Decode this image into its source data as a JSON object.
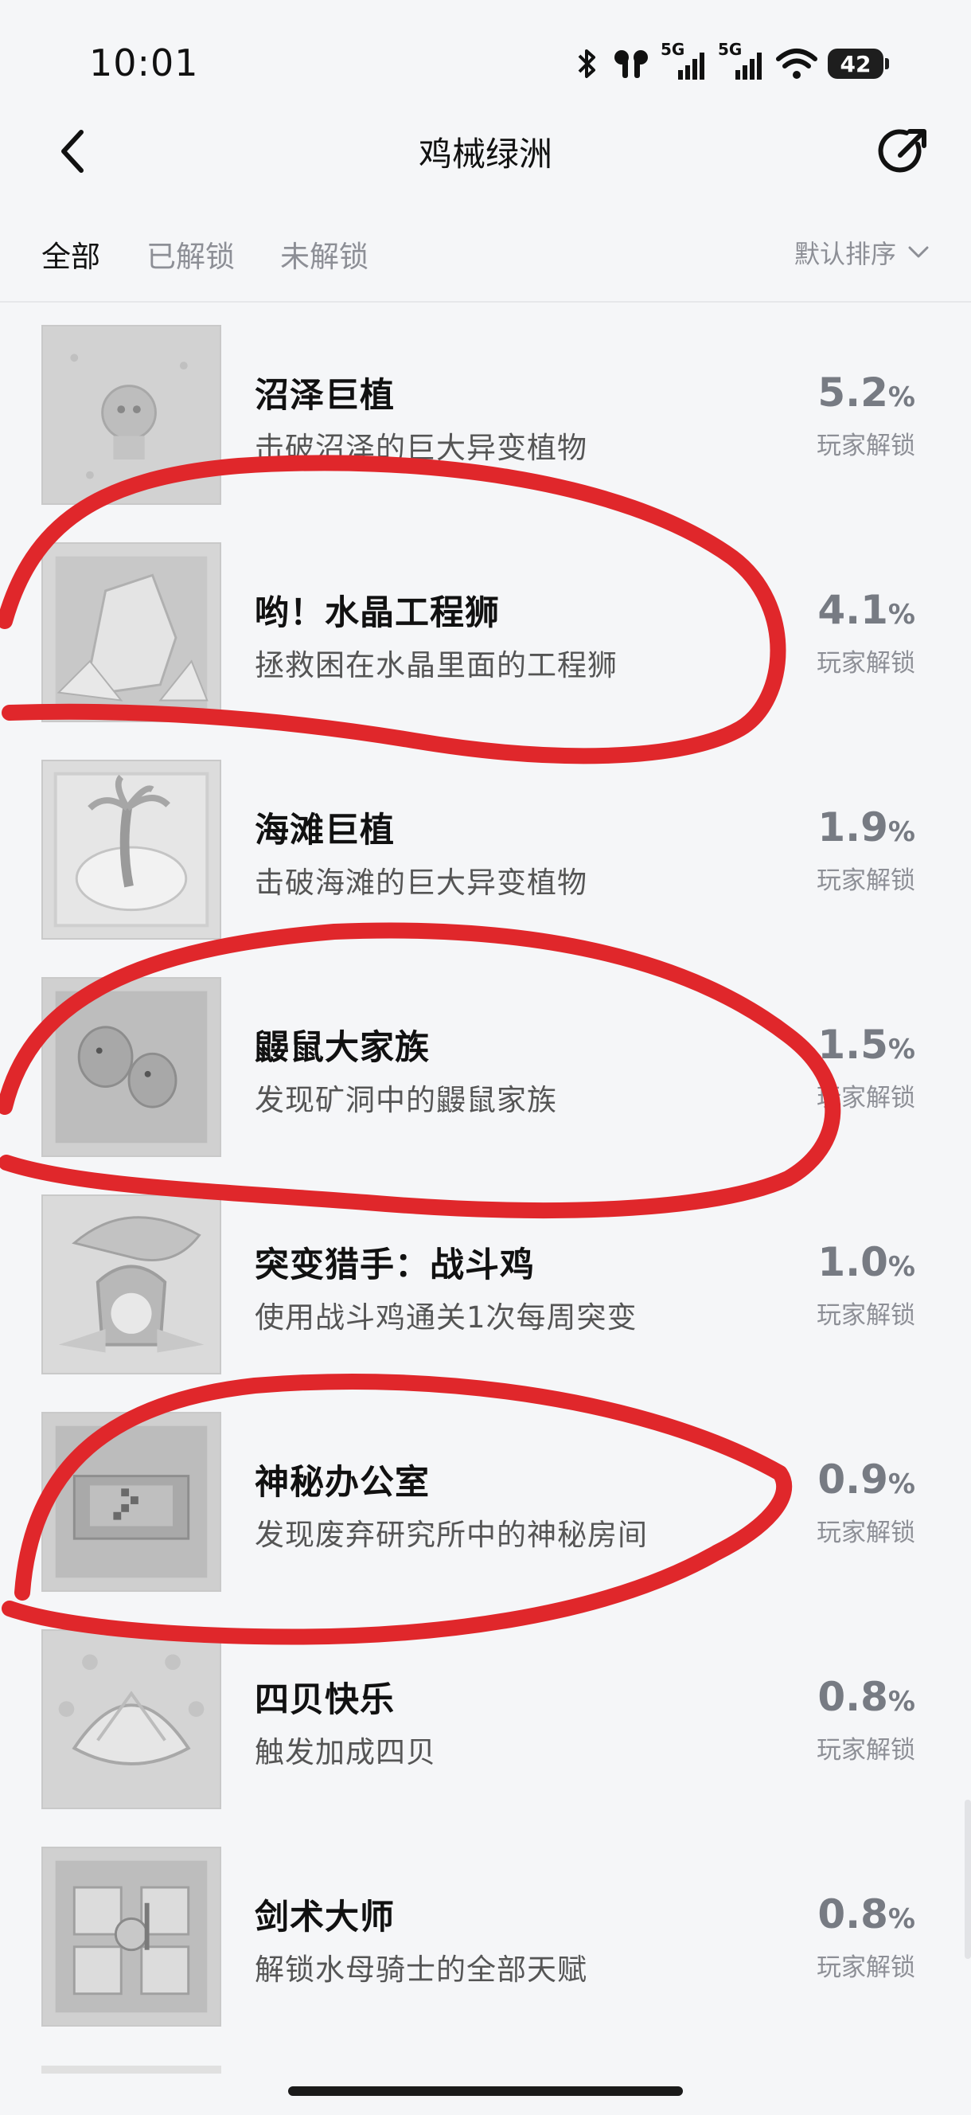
{
  "status_bar": {
    "time": "10:01",
    "signal1_label": "5G",
    "signal2_label": "5G",
    "battery": "42",
    "icons": [
      "bluetooth-icon",
      "earbuds-icon",
      "signal-icon",
      "signal-icon",
      "wifi-icon",
      "battery-icon"
    ]
  },
  "nav": {
    "title": "鸡械绿洲",
    "back_icon": "chevron-left-icon",
    "share_icon": "share-icon"
  },
  "tabs": [
    {
      "label": "全部",
      "active": true
    },
    {
      "label": "已解锁",
      "active": false
    },
    {
      "label": "未解锁",
      "active": false
    }
  ],
  "sort": {
    "label": "默认排序",
    "icon": "chevron-down-icon"
  },
  "achievements": [
    {
      "title": "沼泽巨植",
      "desc": "击破沼泽的巨大异变植物",
      "pct": "5.2",
      "pct_sign": "%",
      "pct_label": "玩家解锁"
    },
    {
      "title": "哟！水晶工程狮",
      "desc": "拯救困在水晶里面的工程狮",
      "pct": "4.1",
      "pct_sign": "%",
      "pct_label": "玩家解锁"
    },
    {
      "title": "海滩巨植",
      "desc": "击破海滩的巨大异变植物",
      "pct": "1.9",
      "pct_sign": "%",
      "pct_label": "玩家解锁"
    },
    {
      "title": "鼹鼠大家族",
      "desc": "发现矿洞中的鼹鼠家族",
      "pct": "1.5",
      "pct_sign": "%",
      "pct_label": "玩家解锁"
    },
    {
      "title": "突变猎手：战斗鸡",
      "desc": "使用战斗鸡通关1次每周突变",
      "pct": "1.0",
      "pct_sign": "%",
      "pct_label": "玩家解锁"
    },
    {
      "title": "神秘办公室",
      "desc": "发现废弃研究所中的神秘房间",
      "pct": "0.9",
      "pct_sign": "%",
      "pct_label": "玩家解锁"
    },
    {
      "title": "四贝快乐",
      "desc": "触发加成四贝",
      "pct": "0.8",
      "pct_sign": "%",
      "pct_label": "玩家解锁"
    },
    {
      "title": "剑术大师",
      "desc": "解锁水母骑士的全部天赋",
      "pct": "0.8",
      "pct_sign": "%",
      "pct_label": "玩家解锁"
    }
  ],
  "colors": {
    "annotation_red": "#e0272b",
    "background": "#f5f6f8",
    "text_primary": "#111111",
    "text_secondary": "#8d8f96"
  }
}
